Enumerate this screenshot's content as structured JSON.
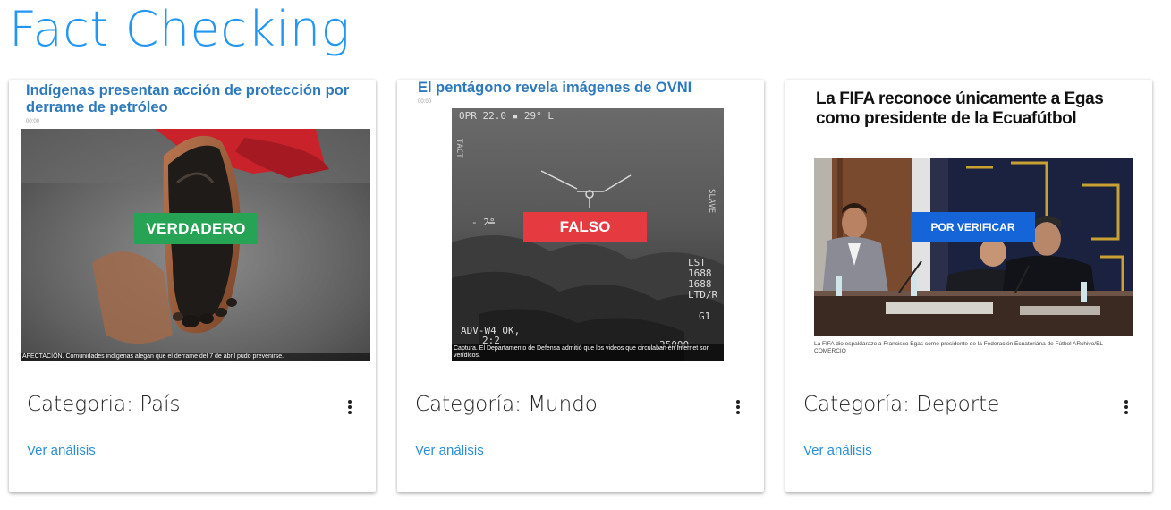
{
  "page": {
    "title": "Fact Checking"
  },
  "cards": [
    {
      "headline": "Indígenas presentan acción de protección por derrame de petróleo",
      "timestamp": "00:00",
      "verdict": "VERDADERO",
      "verdict_color": "#27a355",
      "caption": "AFECTACIÓN. Comunidades indígenas alegan que el derrame del 7 de abril pudo prevenirse.",
      "category": "Categoria: País",
      "link": "Ver análisis"
    },
    {
      "headline": "El pentágono revela imágenes de OVNI",
      "timestamp": "00:00",
      "verdict": "FALSO",
      "verdict_color": "#e53a3f",
      "hud_top": "OPR  22.0 ▪     29° L",
      "hud_mid_left": "- 2°",
      "hud_right": "LST\n1688\n1688\nLTD/R",
      "hud_g1": "G1",
      "hud_bottom_left": "ADV-W4 OK,\n     2:2",
      "hud_bottom_right": "35000",
      "hud_side": "TACT",
      "hud_slave": "SLAVE",
      "caption": "Captura. El Departamento de Defensa admitió que los videos que circulaban en Internet son verídicos.",
      "category": "Categoría: Mundo",
      "link": "Ver análisis"
    },
    {
      "headline": "La FIFA reconoce únicamente a Egas como presidente de la Ecuafútbol",
      "verdict": "POR VERIFICAR",
      "verdict_color": "#1565d8",
      "caption": "La FIFA dio espaldarazo a Francisco Egas como presidente de la Federación Ecuatoriana de Fútbol ARchivo/EL COMERCIO",
      "category": "Categoría: Deporte",
      "link": "Ver análisis"
    }
  ],
  "icons": {
    "card_menu": "more-vert-icon"
  }
}
